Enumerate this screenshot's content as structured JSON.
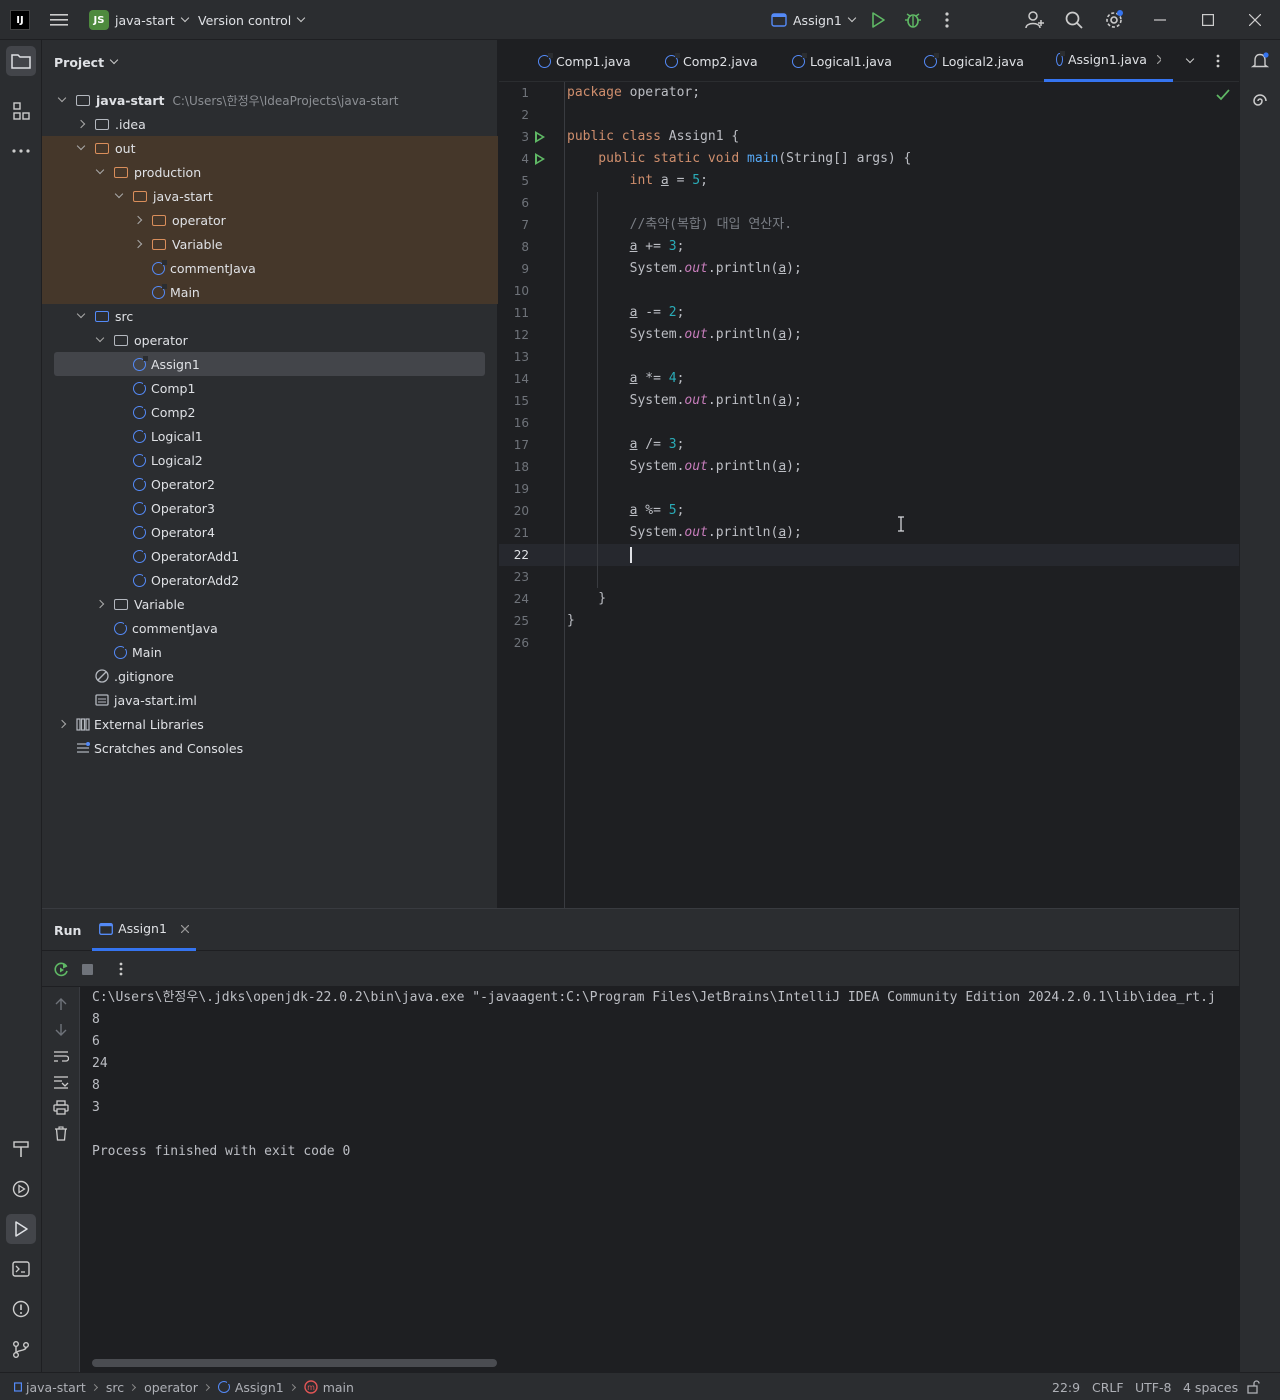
{
  "titlebar": {
    "app_logo": "IJ",
    "project_badge": "JS",
    "project_name": "java-start",
    "vcs": "Version control",
    "run_config": "Assign1"
  },
  "project": {
    "title": "Project",
    "rows": [
      {
        "label": "java-start",
        "path": "C:\\Users\\한정우\\IdeaProjects\\java-start"
      },
      {
        "label": ".idea"
      },
      {
        "label": "out"
      },
      {
        "label": "production"
      },
      {
        "label": "java-start"
      },
      {
        "label": "operator"
      },
      {
        "label": "Variable"
      },
      {
        "label": "commentJava"
      },
      {
        "label": "Main"
      },
      {
        "label": "src"
      },
      {
        "label": "operator"
      },
      {
        "label": "Assign1"
      },
      {
        "label": "Comp1"
      },
      {
        "label": "Comp2"
      },
      {
        "label": "Logical1"
      },
      {
        "label": "Logical2"
      },
      {
        "label": "Operator2"
      },
      {
        "label": "Operator3"
      },
      {
        "label": "Operator4"
      },
      {
        "label": "OperatorAdd1"
      },
      {
        "label": "OperatorAdd2"
      },
      {
        "label": "Variable"
      },
      {
        "label": "commentJava"
      },
      {
        "label": "Main"
      },
      {
        "label": ".gitignore"
      },
      {
        "label": "java-start.iml"
      },
      {
        "label": "External Libraries"
      },
      {
        "label": "Scratches and Consoles"
      }
    ]
  },
  "editor": {
    "tabs": [
      "Comp1.java",
      "Comp2.java",
      "Logical1.java",
      "Logical2.java",
      "Assign1.java"
    ],
    "line_numbers": [
      "1",
      "2",
      "3",
      "4",
      "5",
      "6",
      "7",
      "8",
      "9",
      "10",
      "11",
      "12",
      "13",
      "14",
      "15",
      "16",
      "17",
      "18",
      "19",
      "20",
      "21",
      "22",
      "23",
      "24",
      "25",
      "26"
    ],
    "code": {
      "l1a": "package",
      "l1b": " operator;",
      "l3a": "public class",
      "l3b": " Assign1 {",
      "l4a": "    public static void ",
      "l4b": "main",
      "l4c": "(String[] args) {",
      "l5a": "        int ",
      "l5b": "a",
      "l5c": " = ",
      "l5d": "5",
      "l5e": ";",
      "l7": "        //축약(복합) 대입 연산자.",
      "l8a": "a",
      "l8b": " += ",
      "l8c": "3",
      "l8d": ";",
      "l9a": "        System.",
      "l9b": "out",
      "l9c": ".println(",
      "l9d": "a",
      "l9e": ");",
      "l11a": "a",
      "l11b": " -= ",
      "l11c": "2",
      "l11d": ";",
      "l14a": "a",
      "l14b": " *= ",
      "l14c": "4",
      "l14d": ";",
      "l17a": "a",
      "l17b": " /= ",
      "l17c": "3",
      "l17d": ";",
      "l20a": "a",
      "l20b": " %= ",
      "l20c": "5",
      "l20d": ";",
      "l24": "    }",
      "l25": "}"
    }
  },
  "run": {
    "title": "Run",
    "tab": "Assign1",
    "output": [
      "C:\\Users\\한정우\\.jdks\\openjdk-22.0.2\\bin\\java.exe \"-javaagent:C:\\Program Files\\JetBrains\\IntelliJ IDEA Community Edition 2024.2.0.1\\lib\\idea_rt.j",
      "8",
      "6",
      "24",
      "8",
      "3",
      "",
      "Process finished with exit code 0"
    ]
  },
  "statusbar": {
    "crumbs": [
      "java-start",
      "src",
      "operator",
      "Assign1",
      "main"
    ],
    "position": "22:9",
    "line_sep": "CRLF",
    "encoding": "UTF-8",
    "indent": "4 spaces"
  },
  "colors": {
    "accent": "#3574f0",
    "run_green": "#5fb865",
    "debug_green": "#5fb865",
    "excluded_highlight": "#45372a"
  }
}
